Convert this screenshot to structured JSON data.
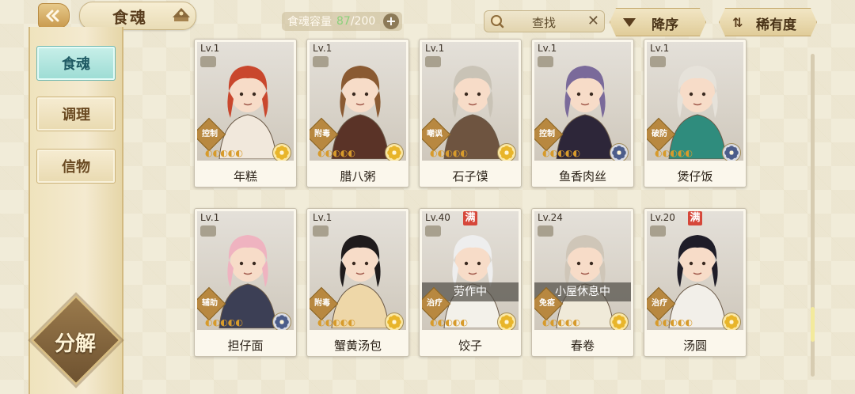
{
  "header": {
    "title": "食魂",
    "capacity_label": "食魂容量",
    "capacity_current": "87",
    "capacity_max": "200",
    "capacity_sep": "/",
    "search_text": "查找",
    "sort_label": "降序",
    "rarity_label": "稀有度"
  },
  "sidebar": {
    "tabs": [
      {
        "label": "食魂",
        "active": true
      },
      {
        "label": "调理",
        "active": false
      },
      {
        "label": "信物",
        "active": false
      }
    ],
    "decompose_label": "分解"
  },
  "cards": [
    {
      "name": "年糕",
      "level": "Lv.1",
      "role": "控制",
      "status": "",
      "full": false,
      "element": "gold-flower",
      "hair": "#c9472d",
      "outfit": "#f1e8dc"
    },
    {
      "name": "腊八粥",
      "level": "Lv.1",
      "role": "附毒",
      "status": "",
      "full": false,
      "element": "gold-flower",
      "hair": "#8a5a32",
      "outfit": "#5a3327"
    },
    {
      "name": "石子馍",
      "level": "Lv.1",
      "role": "嘲讽",
      "status": "",
      "full": false,
      "element": "gold-flower",
      "hair": "#c9c3b6",
      "outfit": "#6e5440"
    },
    {
      "name": "鱼香肉丝",
      "level": "Lv.1",
      "role": "控制",
      "status": "",
      "full": false,
      "element": "blue-flower",
      "hair": "#7a6a9a",
      "outfit": "#2d2639"
    },
    {
      "name": "煲仔饭",
      "level": "Lv.1",
      "role": "破防",
      "status": "",
      "full": false,
      "element": "blue-flower",
      "hair": "#e6e2da",
      "outfit": "#2f8c7d"
    },
    {
      "name": "担仔面",
      "level": "Lv.1",
      "role": "辅助",
      "status": "",
      "full": false,
      "element": "blue-flower",
      "hair": "#efb3c0",
      "outfit": "#3c3f55"
    },
    {
      "name": "蟹黄汤包",
      "level": "Lv.1",
      "role": "附毒",
      "status": "",
      "full": false,
      "element": "gold-flower",
      "hair": "#1f1b1c",
      "outfit": "#eed7a8"
    },
    {
      "name": "饺子",
      "level": "Lv.40",
      "role": "治疗",
      "status": "劳作中",
      "full": true,
      "element": "gold-flower",
      "hair": "#eeeeee",
      "outfit": "#f3f1ea"
    },
    {
      "name": "春卷",
      "level": "Lv.24",
      "role": "免疫",
      "status": "小屋休息中",
      "full": false,
      "element": "gold-flower",
      "hair": "#cfc6b8",
      "outfit": "#f0ead9"
    },
    {
      "name": "汤圆",
      "level": "Lv.20",
      "role": "治疗",
      "status": "",
      "full": true,
      "element": "gold-flower",
      "hair": "#1f1d28",
      "outfit": "#f2efe9"
    }
  ],
  "full_label": "满",
  "colors": {
    "accent_teal": "#9cdcd4",
    "gold": "#d79b2c",
    "badge_red": "#d6473a"
  }
}
